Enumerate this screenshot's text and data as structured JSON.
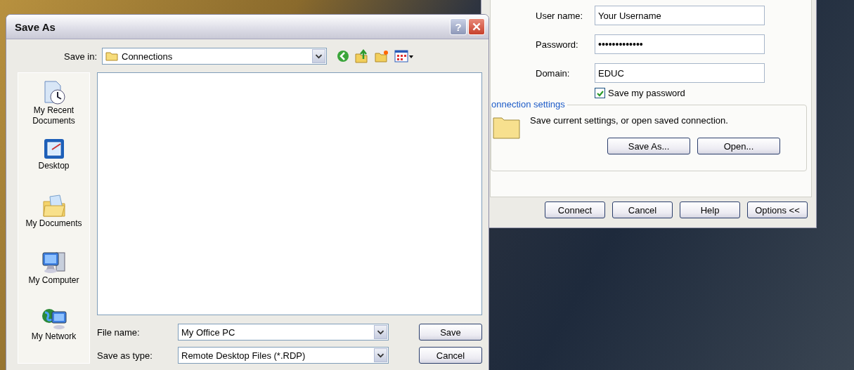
{
  "save_as_dialog": {
    "title": "Save As",
    "help_button": "?",
    "save_in": {
      "label": "Save in:",
      "value": "Connections"
    },
    "places": [
      {
        "label": "My Recent Documents",
        "kind": "recent"
      },
      {
        "label": "Desktop",
        "kind": "desktop"
      },
      {
        "label": "My Documents",
        "kind": "documents"
      },
      {
        "label": "My Computer",
        "kind": "computer"
      },
      {
        "label": "My Network",
        "kind": "network"
      }
    ],
    "file_name": {
      "label": "File name:",
      "value": "My Office PC"
    },
    "save_as_type": {
      "label": "Save as type:",
      "value": "Remote Desktop Files (*.RDP)"
    },
    "buttons": [
      "Save",
      "Cancel"
    ]
  },
  "remote_desktop_dialog": {
    "fields": [
      {
        "label": "User name:",
        "value": "Your Username",
        "kind": "text"
      },
      {
        "label": "Password:",
        "value": "•••••••••••••",
        "kind": "password"
      },
      {
        "label": "Domain:",
        "value": "EDUC",
        "kind": "text"
      }
    ],
    "save_password": {
      "label": "Save my password",
      "checked": true
    },
    "connection_settings": {
      "title": "onnection settings",
      "description": "Save current settings, or open saved connection.",
      "buttons": [
        "Save As...",
        "Open..."
      ]
    },
    "buttons": [
      "Connect",
      "Cancel",
      "Help",
      "Options <<"
    ]
  }
}
